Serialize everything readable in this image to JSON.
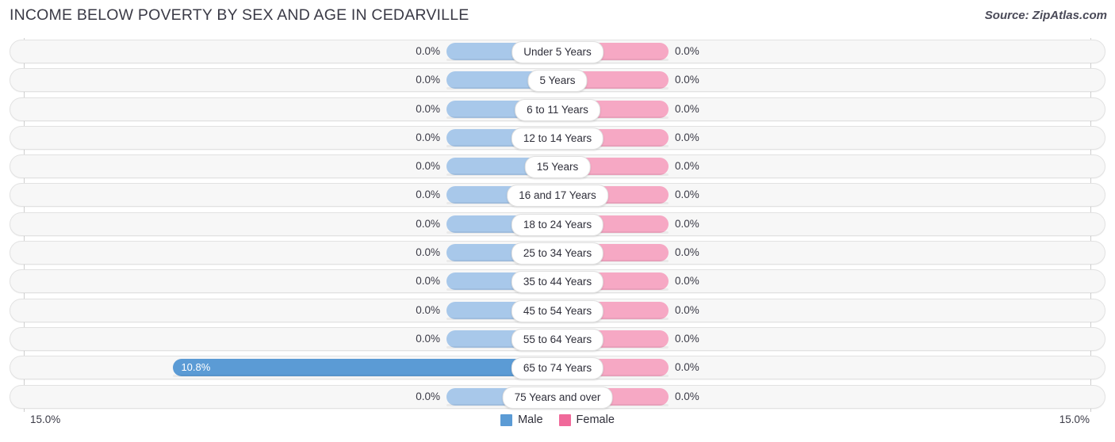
{
  "header": {
    "title": "INCOME BELOW POVERTY BY SEX AND AGE IN CEDARVILLE",
    "source": "Source: ZipAtlas.com"
  },
  "axis": {
    "left_label": "15.0%",
    "right_label": "15.0%"
  },
  "legend": {
    "items": [
      {
        "label": "Male",
        "color": "#5b9bd5"
      },
      {
        "label": "Female",
        "color": "#f0699a"
      }
    ]
  },
  "colors": {
    "male_bar": "#a8c8ea",
    "male_bar_highlight": "#5b9bd5",
    "female_bar": "#f6a8c4",
    "track": "#f7f7f7",
    "pill": "#ffffff"
  },
  "chart_data": {
    "type": "bar",
    "title": "INCOME BELOW POVERTY BY SEX AND AGE IN CEDARVILLE",
    "subtitle": "",
    "xlabel": "",
    "ylabel": "",
    "orientation": "horizontal-diverging",
    "axis_max_percent": 15.0,
    "xlim": [
      15.0,
      15.0
    ],
    "grid": false,
    "legend_position": "bottom-center",
    "categories": [
      "Under 5 Years",
      "5 Years",
      "6 to 11 Years",
      "12 to 14 Years",
      "15 Years",
      "16 and 17 Years",
      "18 to 24 Years",
      "25 to 34 Years",
      "35 to 44 Years",
      "45 to 54 Years",
      "55 to 64 Years",
      "65 to 74 Years",
      "75 Years and over"
    ],
    "series": [
      {
        "name": "Male",
        "values": [
          0.0,
          0.0,
          0.0,
          0.0,
          0.0,
          0.0,
          0.0,
          0.0,
          0.0,
          0.0,
          0.0,
          10.8,
          0.0
        ],
        "labels": [
          "0.0%",
          "0.0%",
          "0.0%",
          "0.0%",
          "0.0%",
          "0.0%",
          "0.0%",
          "0.0%",
          "0.0%",
          "0.0%",
          "0.0%",
          "10.8%",
          "0.0%"
        ]
      },
      {
        "name": "Female",
        "values": [
          0.0,
          0.0,
          0.0,
          0.0,
          0.0,
          0.0,
          0.0,
          0.0,
          0.0,
          0.0,
          0.0,
          0.0,
          0.0
        ],
        "labels": [
          "0.0%",
          "0.0%",
          "0.0%",
          "0.0%",
          "0.0%",
          "0.0%",
          "0.0%",
          "0.0%",
          "0.0%",
          "0.0%",
          "0.0%",
          "0.0%",
          "0.0%"
        ]
      }
    ]
  }
}
